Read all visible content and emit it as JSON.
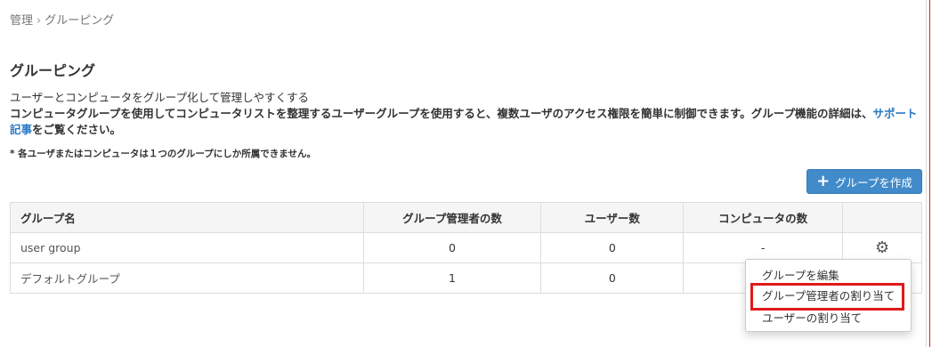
{
  "breadcrumb": {
    "items": [
      "管理",
      "グルーピング"
    ],
    "separator": "›"
  },
  "page": {
    "title": "グルーピング",
    "subtitle": "ユーザーとコンピュータをグループ化して管理しやすくする",
    "body": "コンピュータグループを使用してコンピュータリストを整理するユーザーグループを使用すると、複数ユーザのアクセス権限を簡単に制御できます。グループ機能の詳細は、",
    "link_text": "サポート記事",
    "body_end": "をご覧ください。",
    "note": "* 各ユーザまたはコンピュータは１つのグループにしか所属できません。"
  },
  "toolbar": {
    "create_label": "グループを作成",
    "create_icon": "plus-icon"
  },
  "table": {
    "headers": [
      "グループ名",
      "グループ管理者の数",
      "ユーザー数",
      "コンピュータの数",
      ""
    ],
    "rows": [
      {
        "name": "user group",
        "admins": "0",
        "users": "0",
        "computers": "-",
        "action_icon": "gear-icon"
      },
      {
        "name": "デフォルトグループ",
        "admins": "1",
        "users": "0",
        "computers": ""
      }
    ]
  },
  "dropdown": {
    "items": [
      "グループを編集",
      "グループ管理者の割り当て",
      "ユーザーの割り当て"
    ],
    "highlighted_index": 1
  },
  "colors": {
    "accent": "#428bca",
    "link": "#2a79c3",
    "highlight": "#e01a1a"
  }
}
